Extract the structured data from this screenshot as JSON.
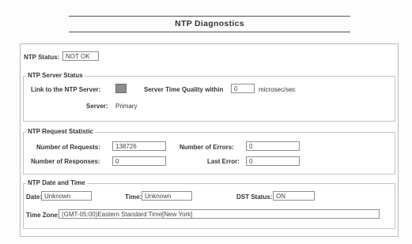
{
  "page": {
    "title": "NTP Diagnostics"
  },
  "ntp_status": {
    "label": "NTP Status:",
    "value": "NOT OK"
  },
  "server_status": {
    "legend": "NTP Server Status",
    "link_label": "Link to the NTP Server:",
    "quality_label": "Server Time Quality within",
    "quality_value": "0",
    "quality_unit": "microsec/sec",
    "server_label": "Server:",
    "server_value": "Primary"
  },
  "request_statistic": {
    "legend": "NTP Request Statistic",
    "requests_label": "Number of Requests:",
    "requests_value": "138726",
    "errors_label": "Number of Errors:",
    "errors_value": "0",
    "responses_label": "Number of Responses:",
    "responses_value": "0",
    "last_error_label": "Last Error:",
    "last_error_value": "0"
  },
  "date_time": {
    "legend": "NTP Date and Time",
    "date_label": "Date:",
    "date_value": "Unknown",
    "time_label": "Time:",
    "time_value": "Unknown",
    "dst_label": "DST Status:",
    "dst_value": "ON",
    "timezone_label": "Time Zone:",
    "timezone_value": "(GMT-05:00)Eastern Standard Time[New York]"
  },
  "colors": {
    "link_indicator": "#8d8d8d",
    "border": "#b9b9b9"
  }
}
